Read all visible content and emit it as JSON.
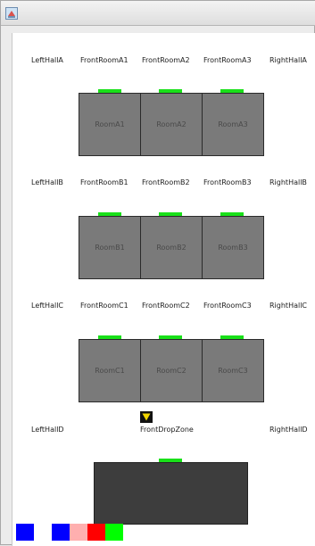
{
  "window": {
    "icon": "java-app-icon"
  },
  "rows": [
    {
      "left": "LeftHallA",
      "fronts": [
        "FrontRoomA1",
        "FrontRoomA2",
        "FrontRoomA3"
      ],
      "right": "RightHallA",
      "rooms": [
        "RoomA1",
        "RoomA2",
        "RoomA3"
      ]
    },
    {
      "left": "LeftHallB",
      "fronts": [
        "FrontRoomB1",
        "FrontRoomB2",
        "FrontRoomB3"
      ],
      "right": "RightHallB",
      "rooms": [
        "RoomB1",
        "RoomB2",
        "RoomB3"
      ]
    },
    {
      "left": "LeftHallC",
      "fronts": [
        "FrontRoomC1",
        "FrontRoomC2",
        "FrontRoomC3"
      ],
      "right": "RightHallC",
      "rooms": [
        "RoomC1",
        "RoomC2",
        "RoomC3"
      ]
    }
  ],
  "row_d": {
    "left": "LeftHallD",
    "front": "FrontDropZone",
    "right": "RightHallD"
  },
  "colors": {
    "led": "#19e019",
    "room": "#7a7a7a",
    "drop_room": "#3d3d3d",
    "marker": "#f2d600",
    "swatches": [
      "#0000ff",
      "#ffffff",
      "#0000ff",
      "#ffafaf",
      "#ff0000",
      "#00ff00"
    ]
  }
}
